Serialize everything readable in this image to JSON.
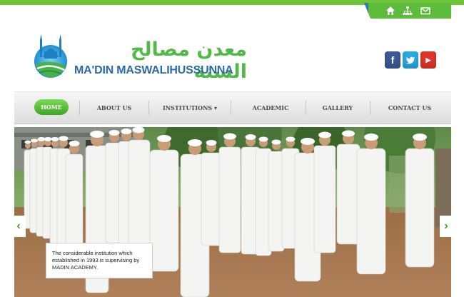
{
  "site": {
    "logo_arabic": "معدن مصالح السنة",
    "logo_english": "MA'DIN MASWALIHUSSUNNA"
  },
  "utility_icons": [
    "home-icon",
    "sitemap-icon",
    "mail-icon"
  ],
  "social": [
    {
      "name": "facebook-icon",
      "glyph": "f",
      "color": "#3b5998"
    },
    {
      "name": "twitter-icon",
      "glyph": "t",
      "color": "#2aa9e0"
    },
    {
      "name": "youtube-icon",
      "glyph": "▶",
      "color": "#e0352b"
    }
  ],
  "nav": {
    "home": "HOME",
    "about": "ABOUT US",
    "institutions": "INSTITUTIONS",
    "institutions_caret": "▾",
    "academic": "ACADEMIC",
    "gallery": "GALLERY",
    "contact": "CONTACT US"
  },
  "slider": {
    "caption": "The considerable institution which established in 1993 is supervising by MADIN ACADEMY.",
    "prev": "‹",
    "next": "›"
  },
  "colors": {
    "accent_green": "#5dbb3a",
    "brand_blue": "#2a6aaa"
  }
}
